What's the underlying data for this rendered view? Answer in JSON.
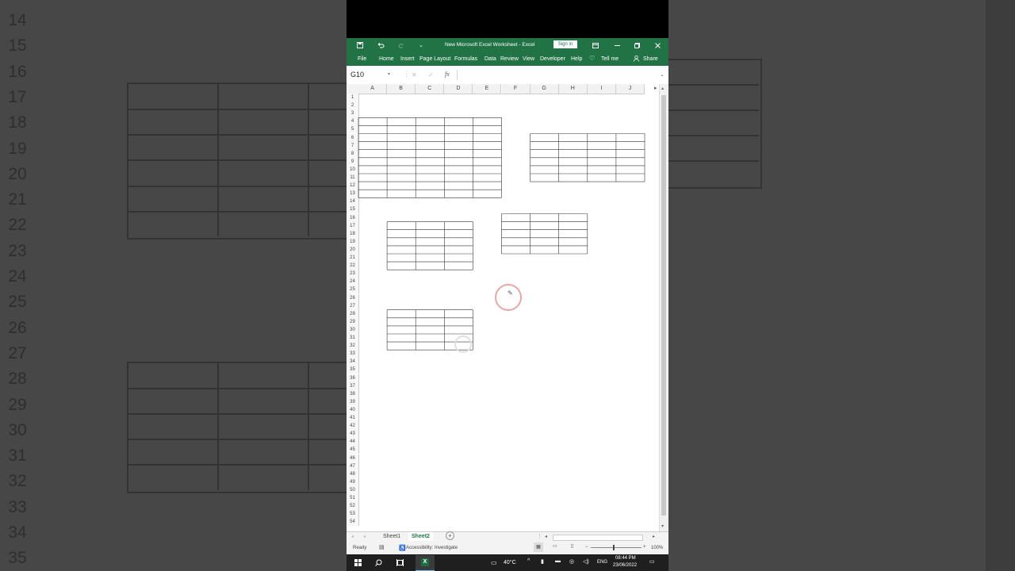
{
  "background": {
    "left_row_numbers": [
      "14",
      "15",
      "16",
      "17",
      "18",
      "19",
      "20",
      "21",
      "22",
      "23",
      "24",
      "25",
      "26",
      "27",
      "28",
      "29",
      "30",
      "31",
      "32",
      "33",
      "34",
      "35"
    ]
  },
  "window": {
    "title": "New Microsoft Excel Worksheet  -  Excel",
    "sign_in": "Sign in",
    "accent": "#217346"
  },
  "ribbon": {
    "tabs": [
      "File",
      "Home",
      "Insert",
      "Page Layout",
      "Formulas",
      "Data",
      "Review",
      "View",
      "Developer",
      "Help"
    ],
    "tell_me": "Tell me",
    "share": "Share"
  },
  "formula_bar": {
    "name_box": "G10",
    "fx": "fx",
    "cancel": "✕",
    "enter": "✓",
    "value": ""
  },
  "grid": {
    "columns": [
      "A",
      "B",
      "C",
      "D",
      "E",
      "F",
      "G",
      "H",
      "I",
      "J"
    ],
    "rows": [
      "1",
      "2",
      "3",
      "4",
      "5",
      "6",
      "7",
      "8",
      "9",
      "10",
      "11",
      "12",
      "13",
      "14",
      "15",
      "16",
      "17",
      "18",
      "19",
      "20",
      "21",
      "22",
      "23",
      "24",
      "25",
      "26",
      "27",
      "28",
      "29",
      "30",
      "31",
      "32",
      "33",
      "34",
      "35",
      "36",
      "37",
      "38",
      "39",
      "40",
      "41",
      "42",
      "43",
      "44",
      "45",
      "46",
      "47",
      "48",
      "49",
      "50",
      "51",
      "52",
      "53",
      "54"
    ]
  },
  "sheet_tabs": {
    "tabs": [
      "Sheet1",
      "Sheet2"
    ],
    "active": "Sheet2",
    "add": "+"
  },
  "status_bar": {
    "ready": "Ready",
    "accessibility": "Accessibility: Investigate",
    "zoom": "100%"
  },
  "taskbar": {
    "temperature": "40°C",
    "language": "ENG",
    "time": "08:44 PM",
    "date": "23/06/2022"
  }
}
